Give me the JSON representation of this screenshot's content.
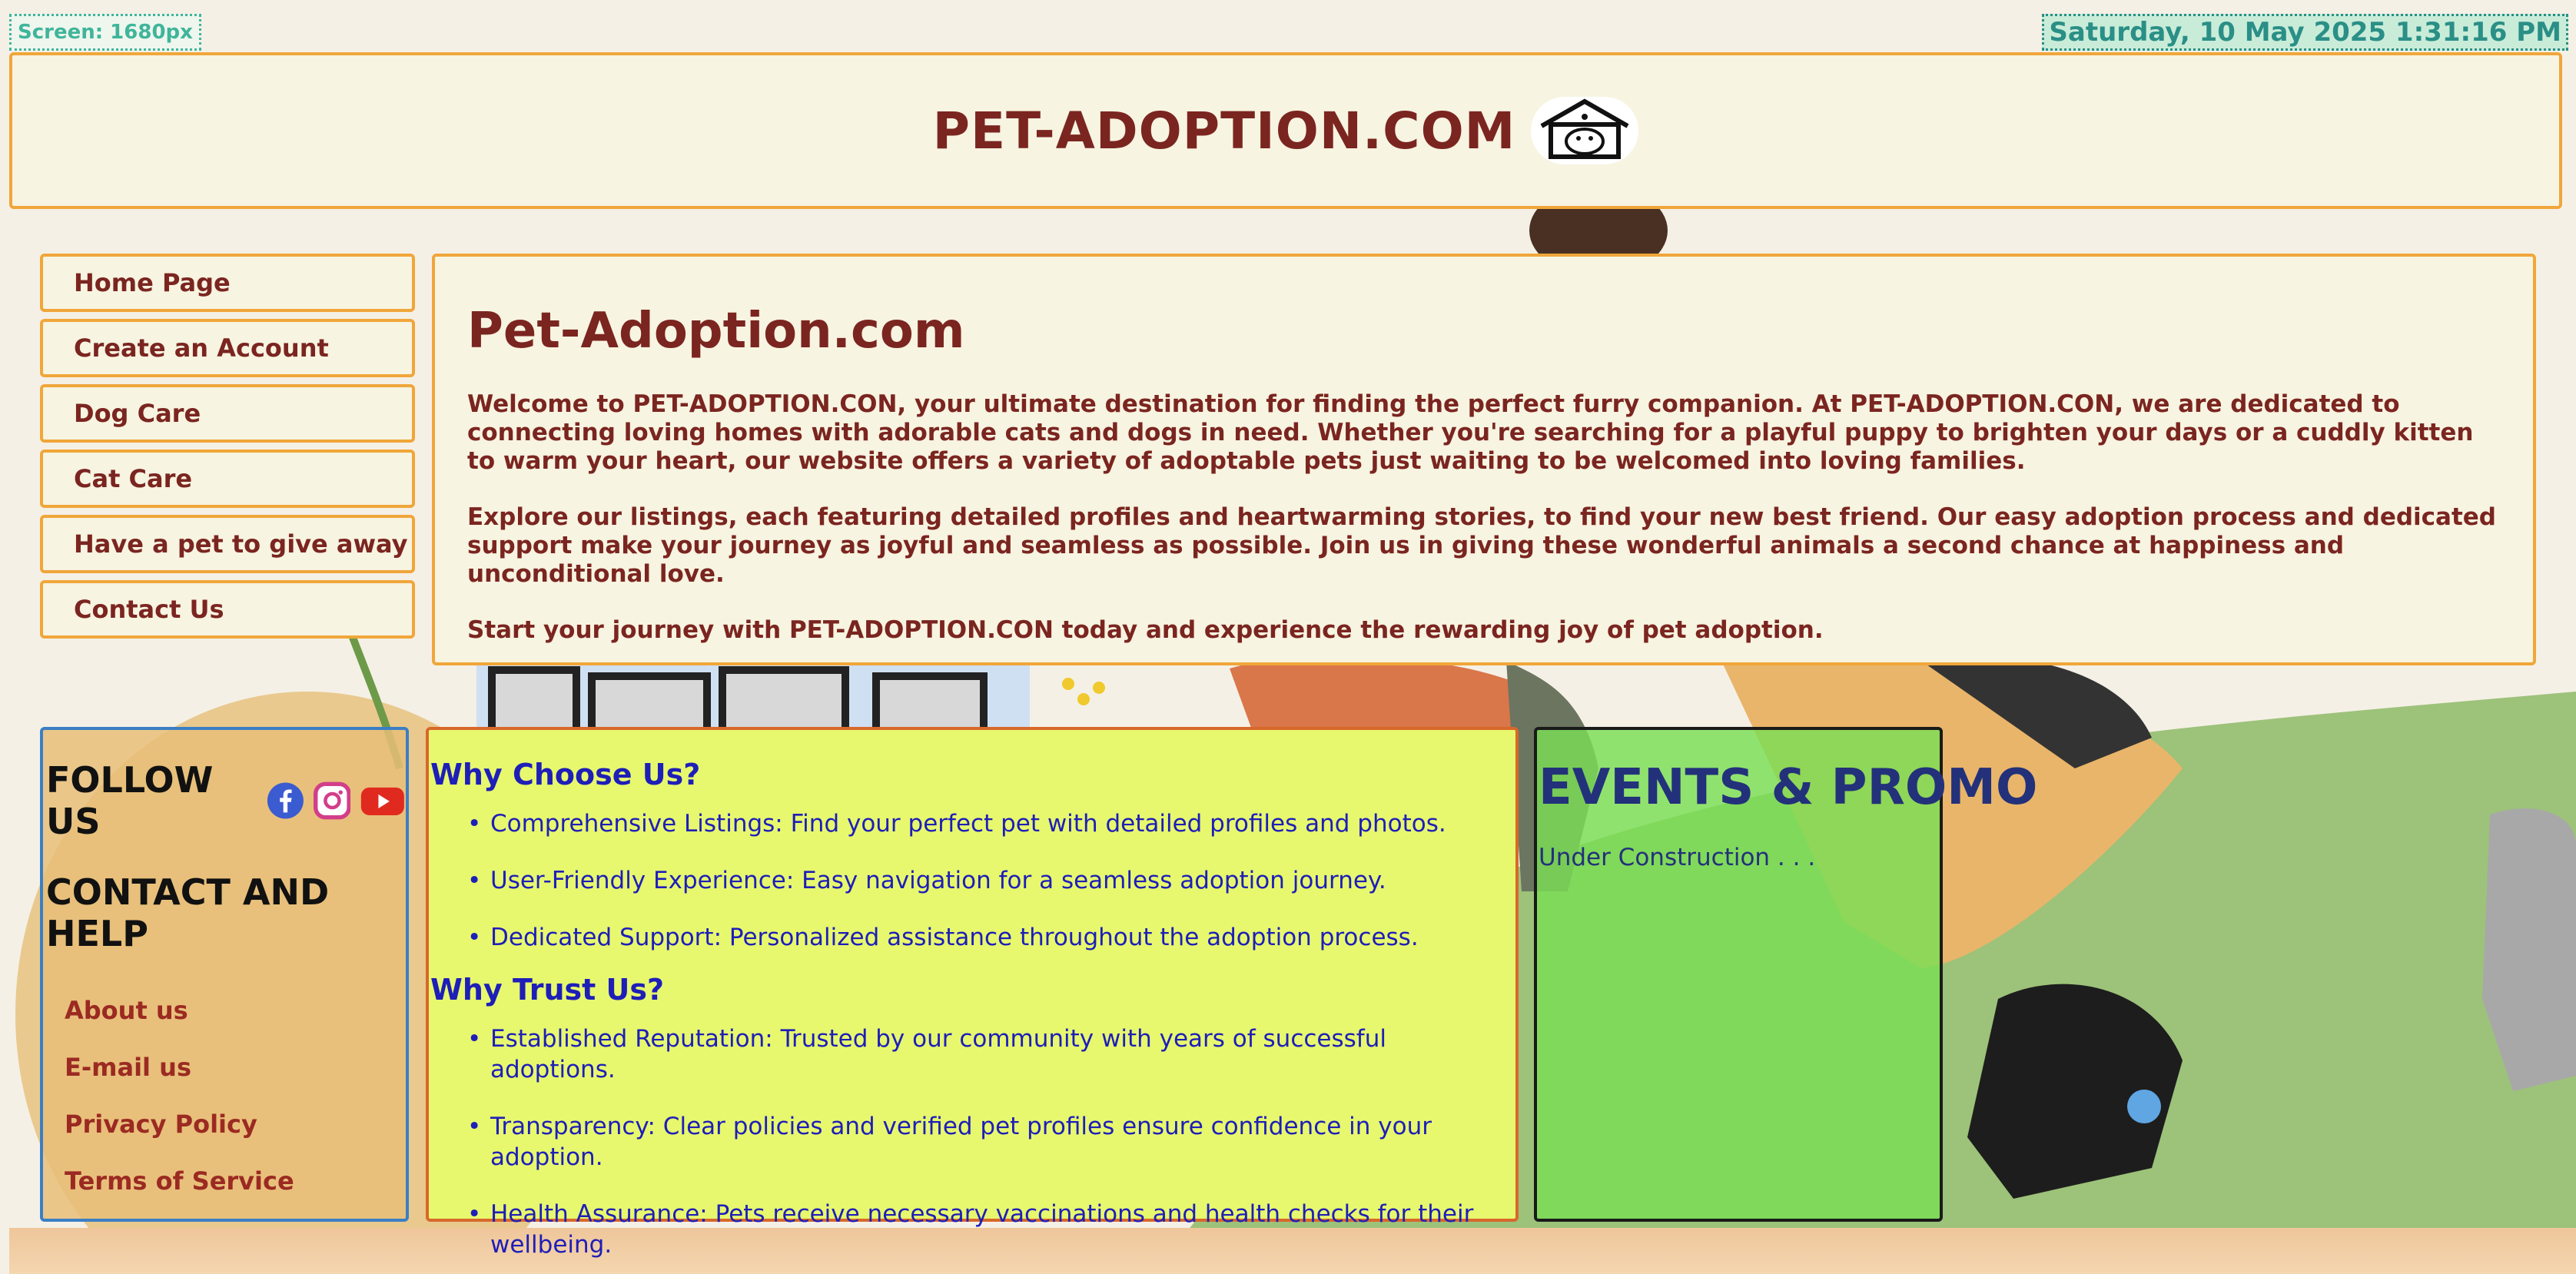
{
  "screen_badge": "Screen: 1680px",
  "datetime": "Saturday, 10 May 2025 1:31:16 PM",
  "header": {
    "site_title": "PET-ADOPTION.COM",
    "logo_icon": "pet-house-logo-icon"
  },
  "nav": {
    "items": [
      {
        "label": "Home Page"
      },
      {
        "label": "Create an Account"
      },
      {
        "label": "Dog Care"
      },
      {
        "label": "Cat Care"
      },
      {
        "label": "Have a pet to give away"
      },
      {
        "label": "Contact Us"
      }
    ]
  },
  "intro": {
    "heading": "Pet-Adoption.com",
    "paragraphs": [
      "Welcome to PET-ADOPTION.CON, your ultimate destination for finding the perfect furry companion. At PET-ADOPTION.CON, we are dedicated to connecting loving homes with adorable cats and dogs in need. Whether you're searching for a playful puppy to brighten your days or a cuddly kitten to warm your heart, our website offers a variety of adoptable pets just waiting to be welcomed into loving families.",
      "Explore our listings, each featuring detailed profiles and heartwarming stories, to find your new best friend. Our easy adoption process and dedicated support make your journey as joyful and seamless as possible. Join us in giving these wonderful animals a second chance at happiness and unconditional love.",
      "Start your journey with PET-ADOPTION.CON today and experience the rewarding joy of pet adoption."
    ]
  },
  "follow": {
    "title": "FOLLOW US",
    "social_icons": [
      "facebook-icon",
      "instagram-icon",
      "youtube-icon"
    ],
    "contact_title": "CONTACT AND HELP",
    "links": [
      {
        "label": "About us"
      },
      {
        "label": "E-mail us"
      },
      {
        "label": "Privacy Policy"
      },
      {
        "label": "Terms of Service"
      }
    ]
  },
  "why": {
    "choose_heading": "Why Choose Us?",
    "choose_items": [
      "Comprehensive Listings: Find your perfect pet with detailed profiles and photos.",
      "User-Friendly Experience: Easy navigation for a seamless adoption journey.",
      "Dedicated Support: Personalized assistance throughout the adoption process."
    ],
    "trust_heading": "Why Trust Us?",
    "trust_items": [
      "Established Reputation: Trusted by our community with years of successful adoptions.",
      "Transparency: Clear policies and verified pet profiles ensure confidence in your adoption.",
      "Health Assurance: Pets receive necessary vaccinations and health checks for their wellbeing."
    ]
  },
  "events": {
    "heading": "EVENTS & PROMO",
    "status": "Under Construction . . ."
  },
  "colors": {
    "accent_orange": "#f0a63a",
    "brand_maroon": "#7b2520",
    "why_bg": "#e7f86e",
    "events_bg": "#7ade54",
    "link_blue": "#1e1eb8"
  }
}
